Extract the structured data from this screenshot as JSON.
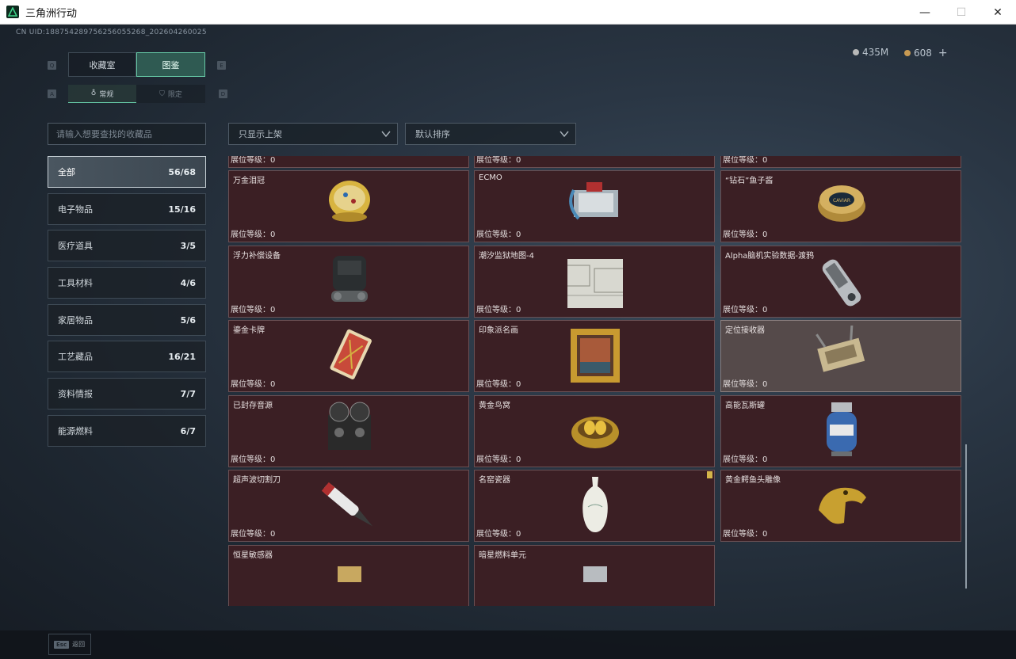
{
  "window": {
    "title": "三角洲行动",
    "controls": [
      "—",
      "☐",
      "✕"
    ]
  },
  "header": {
    "uid": "CN UID:18875428975625605526​8_202604260025",
    "currency_silver": "435M",
    "currency_gold": "608",
    "currency_add": "+"
  },
  "tabs": {
    "key_left": "Q",
    "key_right": "E",
    "items": [
      {
        "label": "收藏室",
        "active": false
      },
      {
        "label": "图鉴",
        "active": true
      }
    ]
  },
  "subtabs": {
    "key_left": "A",
    "key_right": "D",
    "items": [
      {
        "label": "常规",
        "active": true
      },
      {
        "label": "限定",
        "active": false
      }
    ]
  },
  "search": {
    "placeholder": "请输入想要查找的收藏品"
  },
  "filters": {
    "shelf_filter": "只显示上架",
    "sort": "默认排序"
  },
  "categories": [
    {
      "label": "全部",
      "count": "56/68",
      "active": true
    },
    {
      "label": "电子物品",
      "count": "15/16"
    },
    {
      "label": "医疗道具",
      "count": "3/5"
    },
    {
      "label": "工具材料",
      "count": "4/6"
    },
    {
      "label": "家居物品",
      "count": "5/6"
    },
    {
      "label": "工艺藏品",
      "count": "16/21"
    },
    {
      "label": "资料情报",
      "count": "7/7"
    },
    {
      "label": "能源燃料",
      "count": "6/7"
    }
  ],
  "level_prefix": "展位等级：",
  "items": [
    {
      "name": "",
      "level": "0",
      "icon": "crate-icon"
    },
    {
      "name": "",
      "level": "0",
      "icon": "battery-icon"
    },
    {
      "name": "",
      "level": "0",
      "icon": "gramophone-icon"
    },
    {
      "name": "万金泪冠",
      "level": "0",
      "icon": "jewel-egg-icon"
    },
    {
      "name": "ECMO",
      "level": "0",
      "icon": "ecmo-icon"
    },
    {
      "name": "“钻石”鱼子酱",
      "level": "0",
      "icon": "caviar-tin-icon"
    },
    {
      "name": "浮力补偿设备",
      "level": "0",
      "icon": "bcd-vest-icon"
    },
    {
      "name": "潮汐监狱地图-4",
      "level": "0",
      "icon": "map-icon"
    },
    {
      "name": "Alpha脑机实验数据-渡鸦",
      "level": "0",
      "icon": "data-drive-icon"
    },
    {
      "name": "鎏金卡牌",
      "level": "0",
      "icon": "gilded-card-icon"
    },
    {
      "name": "印象派名画",
      "level": "0",
      "icon": "painting-icon"
    },
    {
      "name": "定位接收器",
      "level": "0",
      "icon": "receiver-icon",
      "highlight": true
    },
    {
      "name": "已封存音源",
      "level": "0",
      "icon": "reel-recorder-icon"
    },
    {
      "name": "黄金鸟窝",
      "level": "0",
      "icon": "golden-nest-icon"
    },
    {
      "name": "高能瓦斯罐",
      "level": "0",
      "icon": "gas-canister-icon"
    },
    {
      "name": "超声波切割刀",
      "level": "0",
      "icon": "ultrasonic-knife-icon"
    },
    {
      "name": "名窑瓷器",
      "level": "0",
      "icon": "porcelain-vase-icon",
      "badge": true
    },
    {
      "name": "黄金鳄鱼头雕像",
      "level": "0",
      "icon": "croc-statue-icon"
    },
    {
      "name": "恒星敏感器",
      "level": "",
      "icon": "star-sensor-icon"
    },
    {
      "name": "暗星燃料单元",
      "level": "",
      "icon": "fuel-cell-icon"
    }
  ],
  "footer": {
    "esc_key": "Esc",
    "esc_label": "返回"
  },
  "colors": {
    "accent": "#66c9a6",
    "card_bg": "#3b1f24",
    "card_highlight": "#554a4a"
  }
}
